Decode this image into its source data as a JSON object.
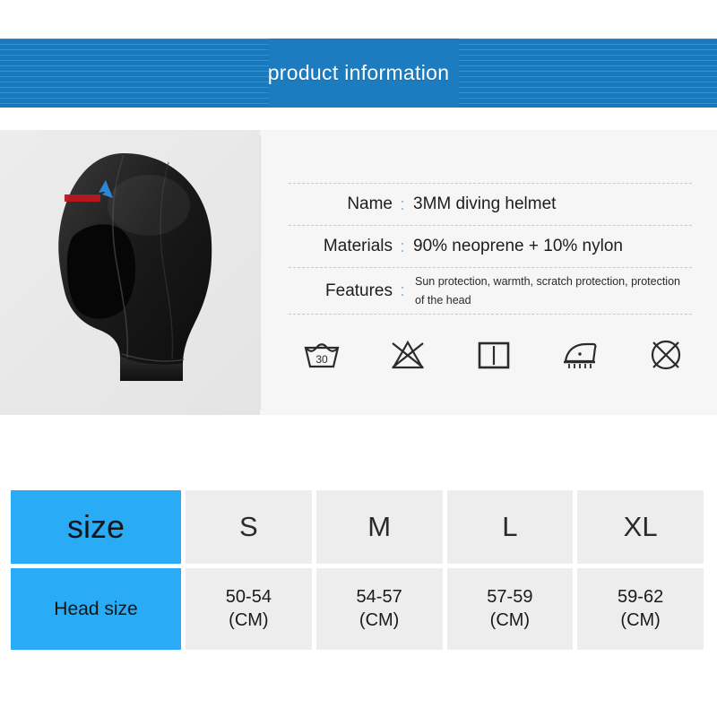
{
  "banner": {
    "title": "product information",
    "bg_color": "#1a79bd",
    "text_color": "#ffffff"
  },
  "product": {
    "photo_alt": "3MM diving helmet hood",
    "logo": {
      "name": "brand-logo",
      "colors": [
        "#c01a1a",
        "#2a7fd4"
      ]
    }
  },
  "specs": {
    "colon": ":",
    "rows": [
      {
        "label": "Name",
        "value": "3MM diving helmet",
        "small": false
      },
      {
        "label": "Materials",
        "value": "90% neoprene + 10% nylon",
        "small": false
      },
      {
        "label": "Features",
        "value": "Sun protection, warmth, scratch protection, protection of the head",
        "small": true
      }
    ]
  },
  "care_icons": [
    {
      "name": "wash-30-icon",
      "label": "30"
    },
    {
      "name": "do-not-bleach-icon",
      "label": ""
    },
    {
      "name": "drip-dry-icon",
      "label": ""
    },
    {
      "name": "steam-iron-icon",
      "label": ""
    },
    {
      "name": "do-not-tumble-dry-icon",
      "label": ""
    }
  ],
  "size_table": {
    "header_color": "#29abf5",
    "cell_color": "#ededed",
    "row_labels": [
      "size",
      "Head size"
    ],
    "sizes": [
      "S",
      "M",
      "L",
      "XL"
    ],
    "head_sizes": [
      "50-54\n(CM)",
      "54-57\n(CM)",
      "57-59\n(CM)",
      "59-62\n(CM)"
    ],
    "head_sizes_parts": [
      {
        "range": "50-54",
        "unit": "(CM)"
      },
      {
        "range": "54-57",
        "unit": "(CM)"
      },
      {
        "range": "57-59",
        "unit": "(CM)"
      },
      {
        "range": "59-62",
        "unit": "(CM)"
      }
    ]
  }
}
